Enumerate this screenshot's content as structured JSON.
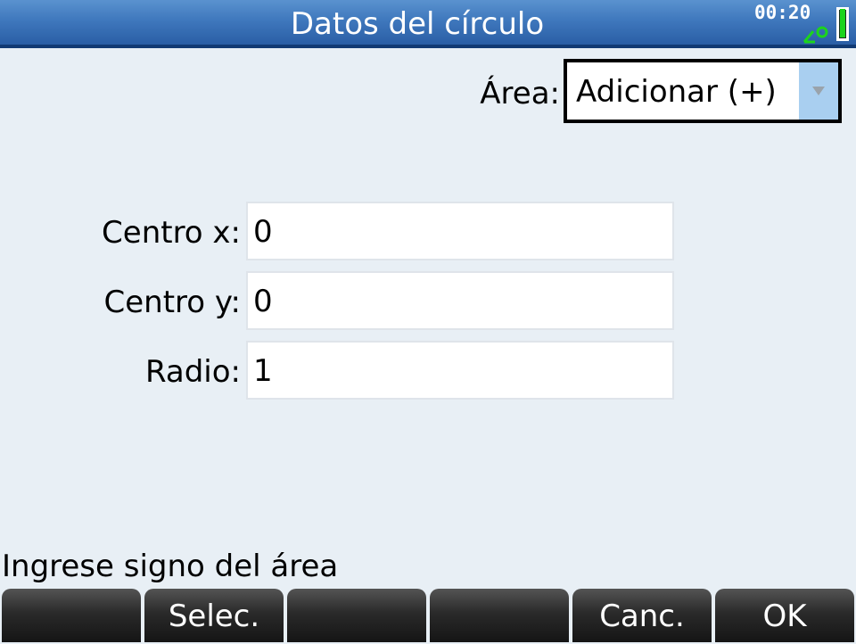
{
  "title": "Datos del círculo",
  "status_bar": {
    "time": "00:20",
    "angle_mode_icon": "degree-angle-icon",
    "battery_level": 1.0
  },
  "area": {
    "label": "Área:",
    "value": "Adicionar (+)"
  },
  "fields": [
    {
      "label": "Centro x:",
      "value": "0"
    },
    {
      "label": "Centro y:",
      "value": "0"
    },
    {
      "label": "Radio:",
      "value": "1"
    }
  ],
  "help_text": "Ingrese signo del área",
  "softkeys": [
    "",
    "Selec.",
    "",
    "",
    "Canc.",
    "OK"
  ],
  "colors": {
    "titlebar": "#3f78bd",
    "background": "#e8eff5",
    "selection": "#a9cff0",
    "battery": "#1cd41c",
    "softkey": "#2a2a2a"
  }
}
